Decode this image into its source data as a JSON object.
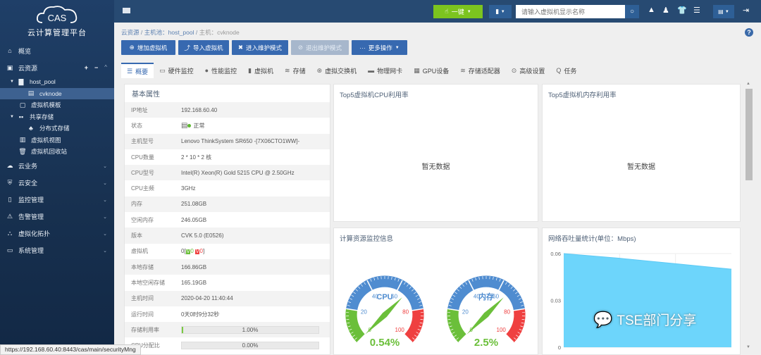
{
  "app": {
    "logo_text": "云计算管理平台",
    "logo_mark": "CAS"
  },
  "sidebar": {
    "items": [
      {
        "label": "概览",
        "icon": "home-icon"
      },
      {
        "label": "云资源",
        "icon": "cloud-resource-icon",
        "controls": [
          "+",
          "−",
          "^"
        ]
      },
      {
        "label": "host_pool",
        "icon": "host-pool-icon"
      },
      {
        "label": "cvknode",
        "icon": "host-node-icon"
      },
      {
        "label": "虚拟机模板",
        "icon": "vm-template-icon"
      },
      {
        "label": "共享存储",
        "icon": "shared-storage-icon"
      },
      {
        "label": "分布式存储",
        "icon": "distributed-storage-icon"
      },
      {
        "label": "虚拟机视图",
        "icon": "vm-view-icon"
      },
      {
        "label": "虚拟机回收站",
        "icon": "recycle-bin-icon"
      },
      {
        "label": "云业务",
        "icon": "cloud-service-icon"
      },
      {
        "label": "云安全",
        "icon": "cloud-security-icon"
      },
      {
        "label": "监控管理",
        "icon": "monitor-icon"
      },
      {
        "label": "告警管理",
        "icon": "alarm-icon"
      },
      {
        "label": "虚拟化拓扑",
        "icon": "topology-icon"
      },
      {
        "label": "系统管理",
        "icon": "system-icon"
      }
    ]
  },
  "topbar": {
    "one_click_label": "一键",
    "search_placeholder": "请输入虚拟机显示名称"
  },
  "breadcrumb": {
    "root": "云资源",
    "pool": "主机池：host_pool",
    "host": "主机：cvknode"
  },
  "actions": {
    "add_vm": "增加虚拟机",
    "import_vm": "导入虚拟机",
    "enter_maint": "进入维护模式",
    "exit_maint": "退出维护模式",
    "more": "更多操作"
  },
  "tabs": [
    "概要",
    "硬件监控",
    "性能监控",
    "虚拟机",
    "存储",
    "虚拟交换机",
    "物理网卡",
    "GPU设备",
    "存储适配器",
    "高级设置",
    "任务"
  ],
  "props": {
    "title": "基本属性",
    "rows": [
      {
        "k": "IP地址",
        "v": "192.168.60.40"
      },
      {
        "k": "状态",
        "v": "正常"
      },
      {
        "k": "主机型号",
        "v": "Lenovo ThinkSystem SR650 -[7X06CTO1WW]-"
      },
      {
        "k": "CPU数量",
        "v": "2 * 10 * 2 核"
      },
      {
        "k": "CPU型号",
        "v": "Intel(R) Xeon(R) Gold 5215 CPU @ 2.50GHz"
      },
      {
        "k": "CPU主频",
        "v": "3GHz"
      },
      {
        "k": "内存",
        "v": "251.08GB"
      },
      {
        "k": "空闲内存",
        "v": "246.05GB"
      },
      {
        "k": "版本",
        "v": "CVK 5.0 (E0526)"
      },
      {
        "k": "虚拟机",
        "v": "0",
        "running": "0",
        "stopped": "0"
      },
      {
        "k": "本地存储",
        "v": "166.86GB"
      },
      {
        "k": "本地空闲存储",
        "v": "165.19GB"
      },
      {
        "k": "主机时间",
        "v": "2020-04-20 11:40:44"
      },
      {
        "k": "运行时间",
        "v": "0天0时9分32秒"
      },
      {
        "k": "存储利用率",
        "v": "1.00%",
        "percent": 1.0
      },
      {
        "k": "CPU分配比",
        "v": "0.00%",
        "percent": 0.0
      }
    ]
  },
  "panels": {
    "cpu_top": {
      "title": "Top5虚拟机CPU利用率",
      "empty": "暂无数据"
    },
    "mem_top": {
      "title": "Top5虚拟机内存利用率",
      "empty": "暂无数据"
    },
    "gauges": {
      "title": "计算资源监控信息"
    },
    "net": {
      "title": "网络吞吐量统计(单位：Mbps)"
    }
  },
  "chart_data": [
    {
      "type": "gauge",
      "title": "CPU",
      "value": 0.54,
      "value_label": "0.54%",
      "range": [
        0,
        100
      ],
      "ticks": [
        "0",
        "20",
        "40",
        "60",
        "80",
        "100"
      ],
      "bands": [
        {
          "to": 20,
          "color": "#6bbf3a"
        },
        {
          "to": 80,
          "color": "#4f8cd0"
        },
        {
          "to": 100,
          "color": "#ef4040"
        }
      ]
    },
    {
      "type": "gauge",
      "title": "内存",
      "value": 2.5,
      "value_label": "2.5%",
      "range": [
        0,
        100
      ],
      "ticks": [
        "0",
        "20",
        "40",
        "60",
        "80",
        "100"
      ],
      "bands": [
        {
          "to": 20,
          "color": "#6bbf3a"
        },
        {
          "to": 80,
          "color": "#4f8cd0"
        },
        {
          "to": 100,
          "color": "#ef4040"
        }
      ]
    },
    {
      "type": "area",
      "title": "网络吞吐量统计(单位：Mbps)",
      "x": [
        0,
        1,
        2,
        3
      ],
      "values": [
        0.06,
        0.057,
        0.0535,
        0.05
      ],
      "ylim": [
        0,
        0.06
      ],
      "yticks": [
        "0",
        "0.03",
        "0.06"
      ],
      "grid": true,
      "color": "#6dd5fb"
    }
  ],
  "statusbar": {
    "url": "https://192.168.60.40:8443/cas/main/securityMng"
  },
  "watermark": {
    "text": "TSE部门分享"
  }
}
